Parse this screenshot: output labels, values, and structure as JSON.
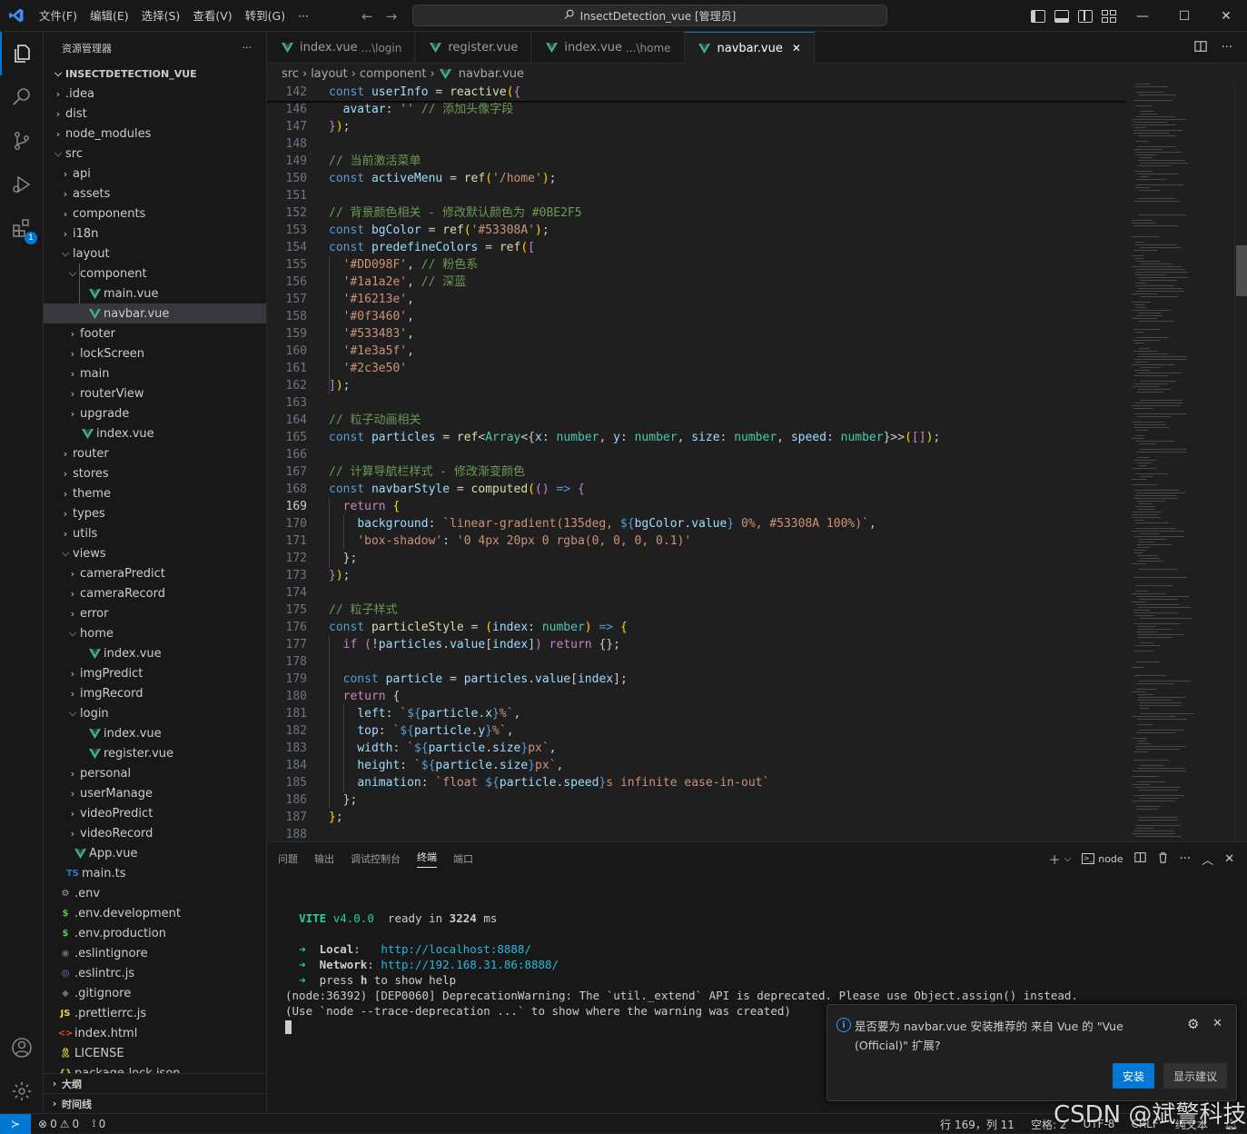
{
  "titlebar": {
    "menu": [
      "文件(F)",
      "编辑(E)",
      "选择(S)",
      "查看(V)",
      "转到(G)",
      "···"
    ],
    "search_text": "InsectDetection_vue [管理员]"
  },
  "sidebar": {
    "title": "资源管理器",
    "more": "···",
    "root": "INSECTDETECTION_VUE",
    "items": [
      {
        "label": ".idea",
        "depth": 1,
        "kind": "folder",
        "open": false
      },
      {
        "label": "dist",
        "depth": 1,
        "kind": "folder",
        "open": false
      },
      {
        "label": "node_modules",
        "depth": 1,
        "kind": "folder",
        "open": false
      },
      {
        "label": "src",
        "depth": 1,
        "kind": "folder",
        "open": true
      },
      {
        "label": "api",
        "depth": 2,
        "kind": "folder",
        "open": false
      },
      {
        "label": "assets",
        "depth": 2,
        "kind": "folder",
        "open": false
      },
      {
        "label": "components",
        "depth": 2,
        "kind": "folder",
        "open": false
      },
      {
        "label": "i18n",
        "depth": 2,
        "kind": "folder",
        "open": false
      },
      {
        "label": "layout",
        "depth": 2,
        "kind": "folder",
        "open": true
      },
      {
        "label": "component",
        "depth": 3,
        "kind": "folder",
        "open": true
      },
      {
        "label": "main.vue",
        "depth": 4,
        "kind": "vue"
      },
      {
        "label": "navbar.vue",
        "depth": 4,
        "kind": "vue",
        "selected": true
      },
      {
        "label": "footer",
        "depth": 3,
        "kind": "folder",
        "open": false
      },
      {
        "label": "lockScreen",
        "depth": 3,
        "kind": "folder",
        "open": false
      },
      {
        "label": "main",
        "depth": 3,
        "kind": "folder",
        "open": false
      },
      {
        "label": "routerView",
        "depth": 3,
        "kind": "folder",
        "open": false
      },
      {
        "label": "upgrade",
        "depth": 3,
        "kind": "folder",
        "open": false
      },
      {
        "label": "index.vue",
        "depth": 3,
        "kind": "vue"
      },
      {
        "label": "router",
        "depth": 2,
        "kind": "folder",
        "open": false
      },
      {
        "label": "stores",
        "depth": 2,
        "kind": "folder",
        "open": false
      },
      {
        "label": "theme",
        "depth": 2,
        "kind": "folder",
        "open": false
      },
      {
        "label": "types",
        "depth": 2,
        "kind": "folder",
        "open": false
      },
      {
        "label": "utils",
        "depth": 2,
        "kind": "folder",
        "open": false
      },
      {
        "label": "views",
        "depth": 2,
        "kind": "folder",
        "open": true
      },
      {
        "label": "cameraPredict",
        "depth": 3,
        "kind": "folder",
        "open": false
      },
      {
        "label": "cameraRecord",
        "depth": 3,
        "kind": "folder",
        "open": false
      },
      {
        "label": "error",
        "depth": 3,
        "kind": "folder",
        "open": false
      },
      {
        "label": "home",
        "depth": 3,
        "kind": "folder",
        "open": true
      },
      {
        "label": "index.vue",
        "depth": 4,
        "kind": "vue"
      },
      {
        "label": "imgPredict",
        "depth": 3,
        "kind": "folder",
        "open": false
      },
      {
        "label": "imgRecord",
        "depth": 3,
        "kind": "folder",
        "open": false
      },
      {
        "label": "login",
        "depth": 3,
        "kind": "folder",
        "open": true
      },
      {
        "label": "index.vue",
        "depth": 4,
        "kind": "vue"
      },
      {
        "label": "register.vue",
        "depth": 4,
        "kind": "vue"
      },
      {
        "label": "personal",
        "depth": 3,
        "kind": "folder",
        "open": false
      },
      {
        "label": "userManage",
        "depth": 3,
        "kind": "folder",
        "open": false
      },
      {
        "label": "videoPredict",
        "depth": 3,
        "kind": "folder",
        "open": false
      },
      {
        "label": "videoRecord",
        "depth": 3,
        "kind": "folder",
        "open": false
      },
      {
        "label": "App.vue",
        "depth": 2,
        "kind": "vue"
      },
      {
        "label": "main.ts",
        "depth": 2,
        "kind": "ts"
      },
      {
        "label": ".env",
        "depth": 1,
        "kind": "gear"
      },
      {
        "label": ".env.development",
        "depth": 1,
        "kind": "dollar"
      },
      {
        "label": ".env.production",
        "depth": 1,
        "kind": "dollar"
      },
      {
        "label": ".eslintignore",
        "depth": 1,
        "kind": "circle"
      },
      {
        "label": ".eslintrc.js",
        "depth": 1,
        "kind": "eslint"
      },
      {
        "label": ".gitignore",
        "depth": 1,
        "kind": "git"
      },
      {
        "label": ".prettierrc.js",
        "depth": 1,
        "kind": "js"
      },
      {
        "label": "index.html",
        "depth": 1,
        "kind": "html"
      },
      {
        "label": "LICENSE",
        "depth": 1,
        "kind": "license"
      },
      {
        "label": "package-lock.json",
        "depth": 1,
        "kind": "json"
      }
    ],
    "outline": "大纲",
    "timeline": "时间线"
  },
  "tabs": [
    {
      "label": "index.vue",
      "hint": "...\\login",
      "active": false
    },
    {
      "label": "register.vue",
      "hint": "",
      "active": false
    },
    {
      "label": "index.vue",
      "hint": "...\\home",
      "active": false
    },
    {
      "label": "navbar.vue",
      "hint": "",
      "active": true,
      "close": "✕"
    }
  ],
  "breadcrumb": [
    "src",
    "layout",
    "component",
    "navbar.vue"
  ],
  "editor": {
    "current_line": 169,
    "lines": [
      {
        "n": 142,
        "html": "<span class='k'>const</span> <span class='v'>userInfo</span> = <span class='f'>reactive</span><span class='p'>(</span><span class='kw'>{</span>"
      },
      {
        "n": 146,
        "html": "  <span class='v'>avatar</span>: <span class='s'>''</span> <span class='cm'>// 添加头像字段</span>"
      },
      {
        "n": 147,
        "html": "<span class='kw'>}</span><span class='p'>)</span>;"
      },
      {
        "n": 148,
        "html": ""
      },
      {
        "n": 149,
        "html": "<span class='cm'>// 当前激活菜单</span>"
      },
      {
        "n": 150,
        "html": "<span class='k'>const</span> <span class='v'>activeMenu</span> = <span class='f'>ref</span><span class='p'>(</span><span class='s'>'/home'</span><span class='p'>)</span>;"
      },
      {
        "n": 151,
        "html": ""
      },
      {
        "n": 152,
        "html": "<span class='cm'>// 背景颜色相关 - 修改默认颜色为 #0BE2F5</span>"
      },
      {
        "n": 153,
        "html": "<span class='k'>const</span> <span class='v'>bgColor</span> = <span class='f'>ref</span><span class='p'>(</span><span class='s'>'#53308A'</span><span class='p'>)</span>;"
      },
      {
        "n": 154,
        "html": "<span class='k'>const</span> <span class='v'>predefineColors</span> = <span class='f'>ref</span><span class='p'>(</span><span class='kw'>[</span>"
      },
      {
        "n": 155,
        "html": "  <span class='s'>'#DD098F'</span>, <span class='cm'>// 粉色系</span>"
      },
      {
        "n": 156,
        "html": "  <span class='s'>'#1a1a2e'</span>, <span class='cm'>// 深蓝</span>"
      },
      {
        "n": 157,
        "html": "  <span class='s'>'#16213e'</span>,"
      },
      {
        "n": 158,
        "html": "  <span class='s'>'#0f3460'</span>,"
      },
      {
        "n": 159,
        "html": "  <span class='s'>'#533483'</span>,"
      },
      {
        "n": 160,
        "html": "  <span class='s'>'#1e3a5f'</span>,"
      },
      {
        "n": 161,
        "html": "  <span class='s'>'#2c3e50'</span>"
      },
      {
        "n": 162,
        "html": "<span class='kw'>]</span><span class='p'>)</span>;"
      },
      {
        "n": 163,
        "html": ""
      },
      {
        "n": 164,
        "html": "<span class='cm'>// 粒子动画相关</span>"
      },
      {
        "n": 165,
        "html": "<span class='k'>const</span> <span class='v'>particles</span> = <span class='f'>ref</span>&lt;<span class='t'>Array</span>&lt;{<span class='v'>x</span>: <span class='t'>number</span>, <span class='v'>y</span>: <span class='t'>number</span>, <span class='v'>size</span>: <span class='t'>number</span>, <span class='v'>speed</span>: <span class='t'>number</span>}&gt;&gt;<span class='p'>(</span><span class='kw'>[]</span><span class='p'>)</span>;"
      },
      {
        "n": 166,
        "html": ""
      },
      {
        "n": 167,
        "html": "<span class='cm'>// 计算导航栏样式 - 修改渐变颜色</span>"
      },
      {
        "n": 168,
        "html": "<span class='k'>const</span> <span class='v'>navbarStyle</span> = <span class='f'>computed</span><span class='p'>(</span><span class='kw'>()</span> <span class='k'>=&gt;</span> <span class='kw'>{</span>"
      },
      {
        "n": 169,
        "html": "  <span class='kw'>return</span> <span class='c2'>{</span>"
      },
      {
        "n": 170,
        "html": "    <span class='v'>background</span>: <span class='s'>`linear-gradient(135deg, </span><span class='k'>${</span><span class='v'>bgColor</span>.<span class='v'>value</span><span class='k'>}</span><span class='s'> 0%, #53308A 100%)`</span>,"
      },
      {
        "n": 171,
        "html": "    <span class='s'>'box-shadow'</span>: <span class='s'>'0 4px 20px 0 rgba(0, 0, 0, 0.1)'</span>"
      },
      {
        "n": 172,
        "html": "  };"
      },
      {
        "n": 173,
        "html": "<span class='kw'>}</span><span class='p'>)</span>;"
      },
      {
        "n": 174,
        "html": ""
      },
      {
        "n": 175,
        "html": "<span class='cm'>// 粒子样式</span>"
      },
      {
        "n": 176,
        "html": "<span class='k'>const</span> <span class='f'>particleStyle</span> = <span class='p'>(</span><span class='v'>index</span>: <span class='t'>number</span><span class='p'>)</span> <span class='k'>=&gt;</span> <span class='p'>{</span>"
      },
      {
        "n": 177,
        "html": "  <span class='kw'>if</span> <span class='kw'>(</span>!<span class='v'>particles</span>.<span class='v'>value</span>[<span class='v'>index</span>]<span class='kw'>)</span> <span class='kw'>return</span> {};"
      },
      {
        "n": 178,
        "html": ""
      },
      {
        "n": 179,
        "html": "  <span class='k'>const</span> <span class='v'>particle</span> = <span class='v'>particles</span>.<span class='v'>value</span>[<span class='v'>index</span>];"
      },
      {
        "n": 180,
        "html": "  <span class='kw'>return</span> {"
      },
      {
        "n": 181,
        "html": "    <span class='v'>left</span>: <span class='s'>`</span><span class='k'>${</span><span class='v'>particle</span>.<span class='v'>x</span><span class='k'>}</span><span class='s'>%`</span>,"
      },
      {
        "n": 182,
        "html": "    <span class='v'>top</span>: <span class='s'>`</span><span class='k'>${</span><span class='v'>particle</span>.<span class='v'>y</span><span class='k'>}</span><span class='s'>%`</span>,"
      },
      {
        "n": 183,
        "html": "    <span class='v'>width</span>: <span class='s'>`</span><span class='k'>${</span><span class='v'>particle</span>.<span class='v'>size</span><span class='k'>}</span><span class='s'>px`</span>,"
      },
      {
        "n": 184,
        "html": "    <span class='v'>height</span>: <span class='s'>`</span><span class='k'>${</span><span class='v'>particle</span>.<span class='v'>size</span><span class='k'>}</span><span class='s'>px`</span>,"
      },
      {
        "n": 185,
        "html": "    <span class='v'>animation</span>: <span class='s'>`float </span><span class='k'>${</span><span class='v'>particle</span>.<span class='v'>speed</span><span class='k'>}</span><span class='s'>s infinite ease-in-out`</span>"
      },
      {
        "n": 186,
        "html": "  };"
      },
      {
        "n": 187,
        "html": "<span class='p'>}</span>;"
      },
      {
        "n": 188,
        "html": ""
      }
    ]
  },
  "panel": {
    "tabs": [
      "问题",
      "输出",
      "调试控制台",
      "终端",
      "端口"
    ],
    "active_tab": "终端",
    "node_label": "node",
    "terminal": {
      "vite": "VITE",
      "version": "v4.0.0",
      "ready": "ready in",
      "ms_value": "3224",
      "ms_unit": "ms",
      "local_label": "Local",
      "local_url": "http://localhost:8888/",
      "network_label": "Network",
      "network_url": "http://192.168.31.86:8888/",
      "help_pre": "press",
      "help_key": "h",
      "help_post": "to show help",
      "warn1": "(node:36392) [DEP0060] DeprecationWarning: The `util._extend` API is deprecated. Please use Object.assign() instead.",
      "warn2": "(Use `node --trace-deprecation ...` to show where the warning was created)"
    }
  },
  "notification": {
    "message": "是否要为 navbar.vue 安装推荐的 来自 Vue 的 \"Vue (Official)\" 扩展?",
    "install": "安装",
    "show": "显示建议",
    "close": "✕"
  },
  "statusbar": {
    "errors": "0",
    "warnings": "0",
    "ports": "0",
    "position": "行 169，列 11",
    "spaces": "空格: 2",
    "encoding": "UTF-8",
    "eol": "CRLF",
    "lang": "纯文本"
  },
  "watermark": "CSDN @斌警科技",
  "activity_badge": "1"
}
